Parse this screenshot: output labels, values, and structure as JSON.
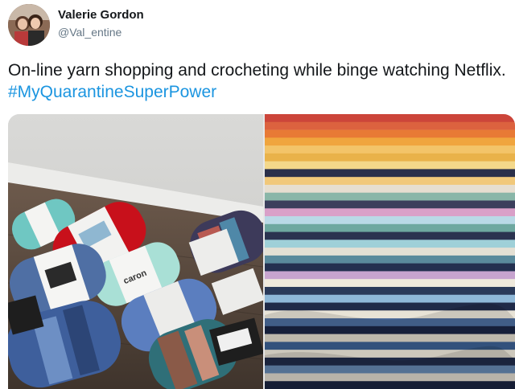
{
  "tweet": {
    "author": {
      "display_name": "Valerie Gordon",
      "handle": "@Val_entine"
    },
    "text": "On-line yarn shopping and crocheting while binge watching Netflix.",
    "hashtag": "#MyQuarantineSuperPower",
    "media": {
      "left_photo": "yarn-skeins-photo",
      "right_photo": "striped-crochet-blanket-photo",
      "yarn_label_text": "caron"
    }
  },
  "colors": {
    "text": "#14171a",
    "handle": "#657786",
    "hashtag": "#1b95e0"
  },
  "icons": {
    "avatar": "profile-photo-avatar"
  }
}
